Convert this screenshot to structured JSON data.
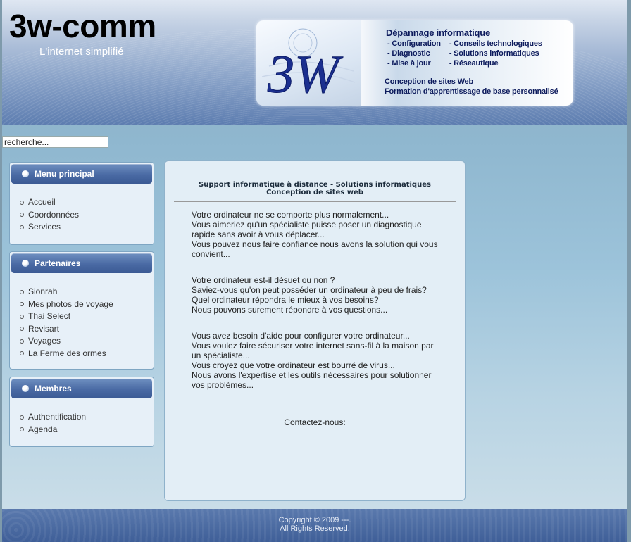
{
  "header": {
    "site_title": "3w-comm",
    "slogan": "L'internet simplifié"
  },
  "banner": {
    "logo_text": "3W",
    "heading": "Dépannage informatique",
    "col1": [
      "- Configuration",
      "- Diagnostic",
      "- Mise à jour"
    ],
    "col2": [
      "- Conseils technologiques",
      "- Solutions informatiques",
      "- Réseautique"
    ],
    "line1": "Conception de sites Web",
    "line2": "Formation d'apprentissage de base personnalisé"
  },
  "search": {
    "value": "recherche..."
  },
  "modules": {
    "menu": {
      "title": "Menu principal",
      "items": [
        "Accueil",
        "Coordonnées",
        "Services"
      ]
    },
    "partners": {
      "title": "Partenaires",
      "items": [
        "Sionrah",
        "Mes photos de voyage",
        "Thai Select",
        "Revisart",
        "Voyages",
        "La Ferme des ormes"
      ]
    },
    "members": {
      "title": "Membres",
      "items": [
        "Authentification",
        "Agenda"
      ]
    }
  },
  "content": {
    "heading_line1": "Support informatique à distance - Solutions informatiques",
    "heading_line2": "Conception de sites web",
    "paragraphs": [
      [
        "Votre ordinateur ne se comporte plus normalement...",
        "Vous aimeriez qu'un spécialiste puisse poser un diagnostique rapide sans avoir à vous déplacer...",
        "Vous pouvez nous faire confiance nous avons la solution qui vous convient..."
      ],
      [
        "Votre ordinateur est-il désuet ou non ?",
        "Saviez-vous qu'on peut posséder un ordinateur à peu de frais?",
        "Quel ordinateur répondra le mieux à vos besoins?",
        "Nous pouvons surement répondre à vos questions..."
      ],
      [
        "Vous avez besoin d'aide pour configurer votre ordinateur...",
        "Vous voulez faire sécuriser votre internet sans-fil à la maison par un spécialiste...",
        "Vous croyez que votre ordinateur est bourré de virus...",
        "Nous avons l'expertise et les outils nécessaires pour solutionner vos problèmes..."
      ]
    ],
    "contact": "Contactez-nous:"
  },
  "footer": {
    "line1": "Copyright © 2009 ---.",
    "line2": "All Rights Reserved."
  },
  "colors": {
    "header_dark": "#5d7db0",
    "module_head": "#4a6aa4",
    "banner_text": "#0c1a5c"
  }
}
